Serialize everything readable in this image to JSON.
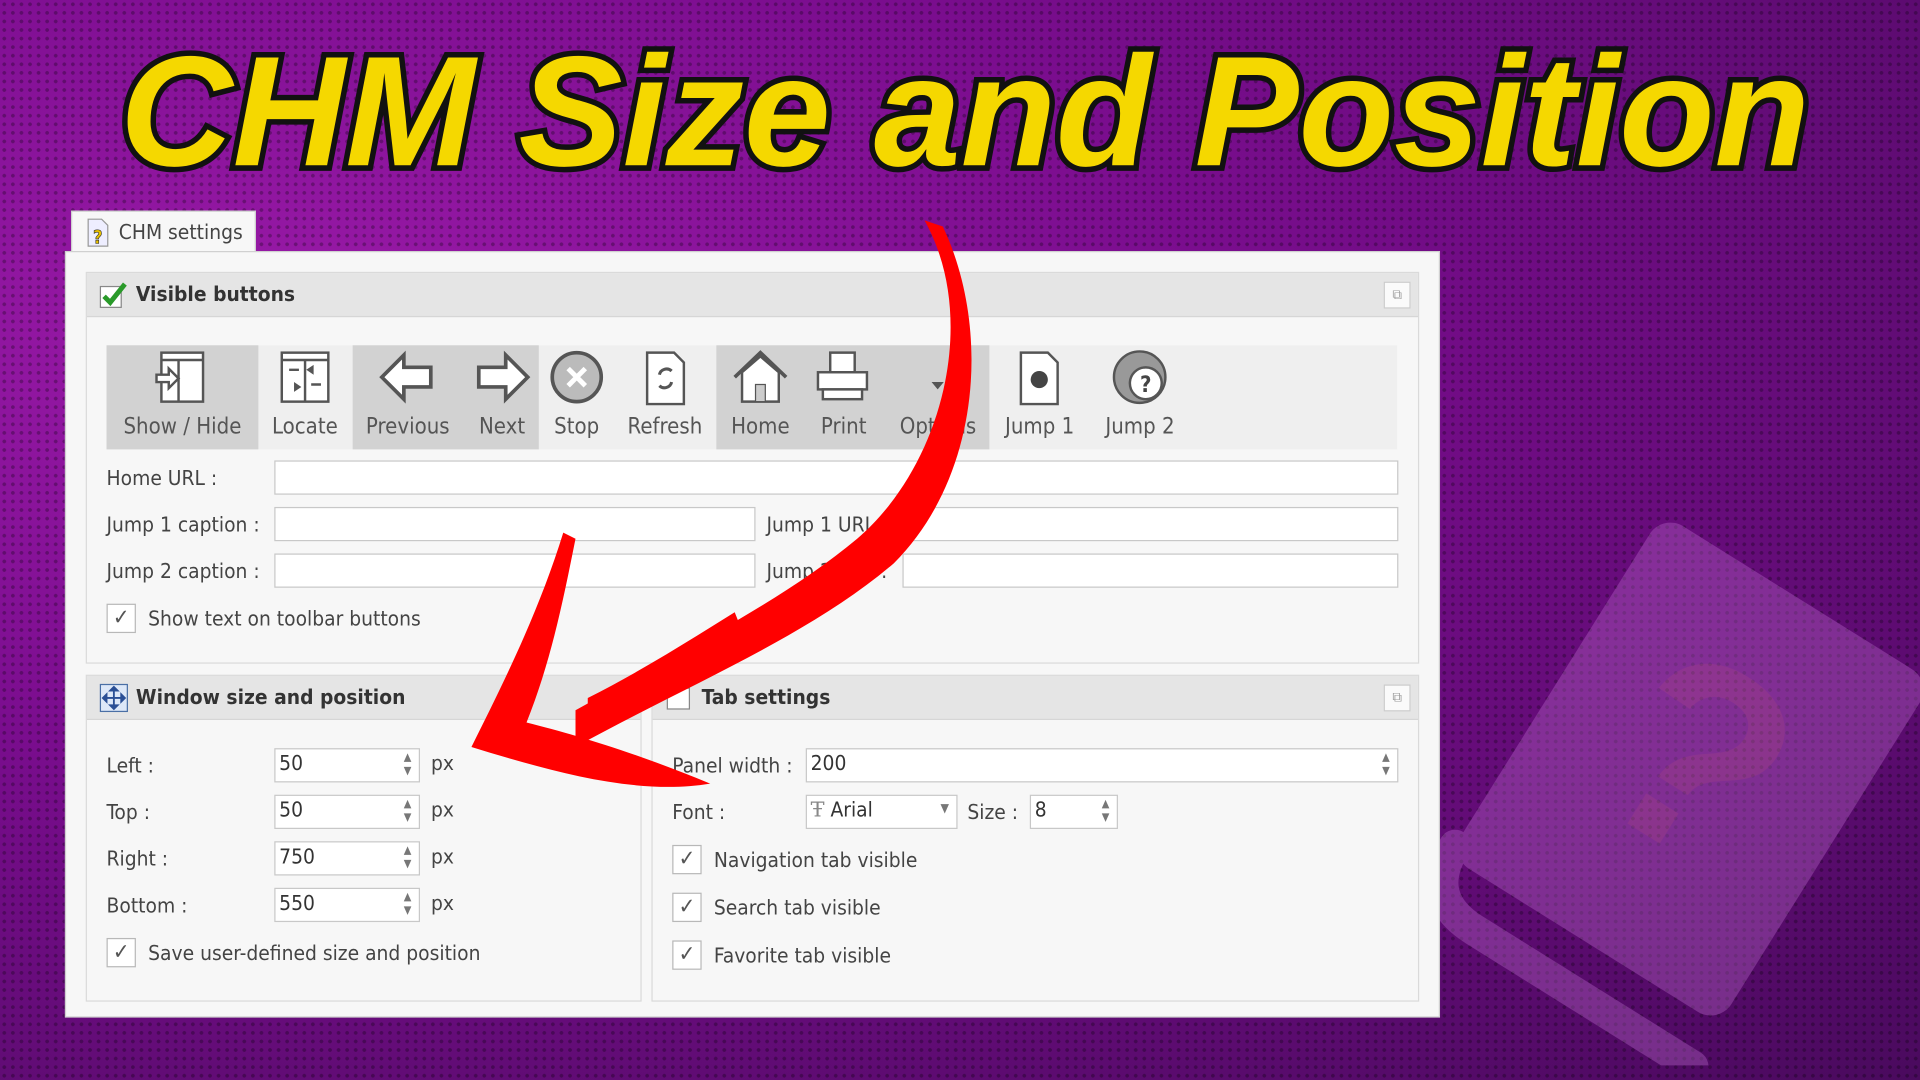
{
  "title": "CHM Size and Position",
  "colors": {
    "title": "#f5d800",
    "arrow": "#ff0000",
    "background": "#7a0d8e"
  },
  "tab": {
    "label": "CHM settings",
    "icon": "help-file-icon"
  },
  "visible_buttons": {
    "title": "Visible buttons",
    "buttons": [
      {
        "label": "Show / Hide",
        "icon": "show-hide-icon",
        "selected": true
      },
      {
        "label": "Locate",
        "icon": "locate-icon",
        "selected": false
      },
      {
        "label": "Previous",
        "icon": "arrow-left-icon",
        "selected": true
      },
      {
        "label": "Next",
        "icon": "arrow-right-icon",
        "selected": true
      },
      {
        "label": "Stop",
        "icon": "stop-icon",
        "selected": false
      },
      {
        "label": "Refresh",
        "icon": "refresh-icon",
        "selected": false
      },
      {
        "label": "Home",
        "icon": "home-icon",
        "selected": true
      },
      {
        "label": "Print",
        "icon": "print-icon",
        "selected": true
      },
      {
        "label": "Options",
        "icon": "options-icon",
        "selected": true
      },
      {
        "label": "Jump 1",
        "icon": "jump-icon",
        "selected": false
      },
      {
        "label": "Jump 2",
        "icon": "help-globe-icon",
        "selected": false
      }
    ],
    "home_url_label": "Home URL :",
    "home_url": "",
    "jump1_caption_label": "Jump 1 caption :",
    "jump1_caption": "",
    "jump1_url_label": "Jump 1 URL :",
    "jump1_url": "",
    "jump2_caption_label": "Jump 2 caption :",
    "jump2_caption": "",
    "jump2_url_label": "Jump 2 URL :",
    "jump2_url": "",
    "show_text_label": "Show text on toolbar buttons",
    "show_text": true
  },
  "window": {
    "title": "Window size and position",
    "unit": "px",
    "fields": [
      {
        "label": "Left :",
        "value": "50"
      },
      {
        "label": "Top :",
        "value": "50"
      },
      {
        "label": "Right :",
        "value": "750"
      },
      {
        "label": "Bottom :",
        "value": "550"
      }
    ],
    "save_label": "Save user-defined size and position",
    "save": true
  },
  "tabs": {
    "title": "Tab settings",
    "panel_width_label": "Panel width :",
    "panel_width": "200",
    "font_label": "Font :",
    "font": "Arial",
    "size_label": "Size :",
    "size": "8",
    "checks": [
      {
        "label": "Navigation tab visible",
        "checked": true
      },
      {
        "label": "Search tab visible",
        "checked": true
      },
      {
        "label": "Favorite tab visible",
        "checked": true
      }
    ]
  }
}
